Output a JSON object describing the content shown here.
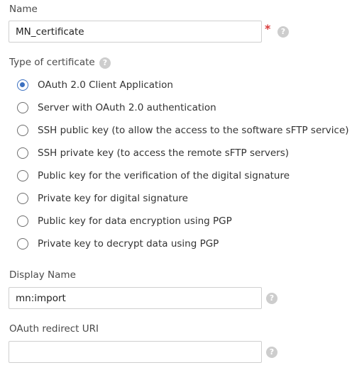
{
  "form": {
    "name": {
      "label": "Name",
      "value": "MN_certificate",
      "required_mark": "*",
      "help_icon": "?"
    },
    "certificate_type": {
      "label": "Type of certificate",
      "help_icon": "?",
      "selected_index": 0,
      "options": [
        {
          "label": "OAuth 2.0 Client Application",
          "checked": true
        },
        {
          "label": "Server with OAuth 2.0 authentication",
          "checked": false
        },
        {
          "label": "SSH public key (to allow the access to the software sFTP service)",
          "checked": false
        },
        {
          "label": "SSH private key (to access the remote sFTP servers)",
          "checked": false
        },
        {
          "label": "Public key for the verification of the digital signature",
          "checked": false
        },
        {
          "label": "Private key for digital signature",
          "checked": false
        },
        {
          "label": "Public key for data encryption using PGP",
          "checked": false
        },
        {
          "label": "Private key to decrypt data using PGP",
          "checked": false
        }
      ]
    },
    "display_name": {
      "label": "Display Name",
      "value": "mn:import",
      "help_icon": "?"
    },
    "oauth_redirect_uri": {
      "label": "OAuth redirect URI",
      "value": "",
      "help_icon": "?"
    }
  },
  "colors": {
    "accent": "#3a6fc0",
    "required": "#d93a3a",
    "help_icon_bg": "#cdcdcd",
    "input_border": "#cfcfcf"
  }
}
